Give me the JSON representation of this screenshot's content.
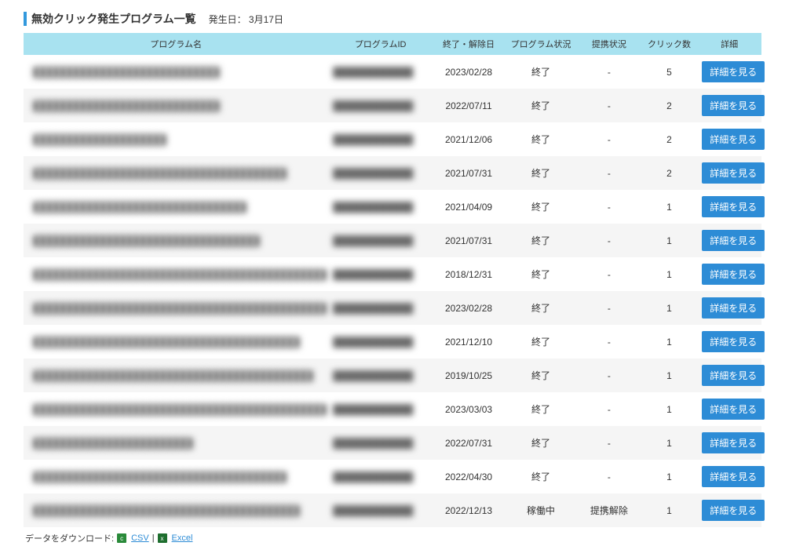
{
  "header": {
    "title": "無効クリック発生プログラム一覧",
    "subtitle": "発生日： 3月17日"
  },
  "columns": {
    "name": "プログラム名",
    "id": "プログラムID",
    "date": "終了・解除日",
    "status": "プログラム状況",
    "partner": "提携状況",
    "clicks": "クリック数",
    "detail": "詳細"
  },
  "detail_button": "詳細を見る",
  "rows": [
    {
      "name": "████████████████████████████",
      "pid": "████████████",
      "date": "2023/02/28",
      "status": "終了",
      "partner": "-",
      "clicks": "5"
    },
    {
      "name": "████████████████████████████",
      "pid": "████████████",
      "date": "2022/07/11",
      "status": "終了",
      "partner": "-",
      "clicks": "2"
    },
    {
      "name": "████████████████████",
      "pid": "████████████",
      "date": "2021/12/06",
      "status": "終了",
      "partner": "-",
      "clicks": "2"
    },
    {
      "name": "██████████████████████████████████████",
      "pid": "████████████",
      "date": "2021/07/31",
      "status": "終了",
      "partner": "-",
      "clicks": "2"
    },
    {
      "name": "████████████████████████████████",
      "pid": "████████████",
      "date": "2021/04/09",
      "status": "終了",
      "partner": "-",
      "clicks": "1"
    },
    {
      "name": "██████████████████████████████████",
      "pid": "████████████",
      "date": "2021/07/31",
      "status": "終了",
      "partner": "-",
      "clicks": "1"
    },
    {
      "name": "████████████████████████████████████████████",
      "pid": "████████████",
      "date": "2018/12/31",
      "status": "終了",
      "partner": "-",
      "clicks": "1"
    },
    {
      "name": "████████████████████████████████████████████",
      "pid": "████████████",
      "date": "2023/02/28",
      "status": "終了",
      "partner": "-",
      "clicks": "1"
    },
    {
      "name": "████████████████████████████████████████",
      "pid": "████████████",
      "date": "2021/12/10",
      "status": "終了",
      "partner": "-",
      "clicks": "1"
    },
    {
      "name": "██████████████████████████████████████████",
      "pid": "████████████",
      "date": "2019/10/25",
      "status": "終了",
      "partner": "-",
      "clicks": "1"
    },
    {
      "name": "████████████████████████████████████████████",
      "pid": "████████████",
      "date": "2023/03/03",
      "status": "終了",
      "partner": "-",
      "clicks": "1"
    },
    {
      "name": "████████████████████████",
      "pid": "████████████",
      "date": "2022/07/31",
      "status": "終了",
      "partner": "-",
      "clicks": "1"
    },
    {
      "name": "██████████████████████████████████████",
      "pid": "████████████",
      "date": "2022/04/30",
      "status": "終了",
      "partner": "-",
      "clicks": "1"
    },
    {
      "name": "████████████████████████████████████████",
      "pid": "████████████",
      "date": "2022/12/13",
      "status": "稼働中",
      "partner": "提携解除",
      "clicks": "1"
    }
  ],
  "footer": {
    "label": "データをダウンロード:",
    "csv": "CSV",
    "excel": "Excel"
  }
}
